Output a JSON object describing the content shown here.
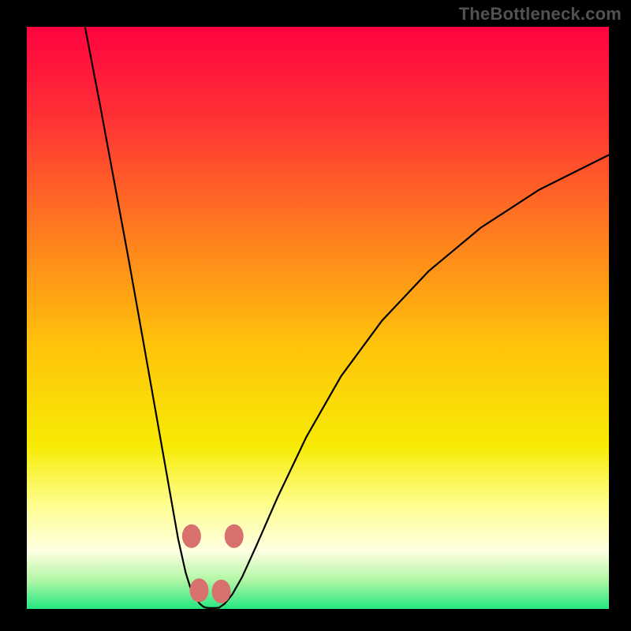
{
  "attribution": "TheBottleneck.com",
  "chart_data": {
    "type": "line",
    "title": "",
    "xlabel": "",
    "ylabel": "",
    "xlim": [
      0,
      100
    ],
    "ylim": [
      0,
      100
    ],
    "grid": false,
    "legend": false,
    "background_gradient": {
      "type": "vertical",
      "stops": [
        {
          "pos": 0.0,
          "color": "#ff0340"
        },
        {
          "pos": 0.15,
          "color": "#ff2f35"
        },
        {
          "pos": 0.35,
          "color": "#ff7b1f"
        },
        {
          "pos": 0.55,
          "color": "#ffc40a"
        },
        {
          "pos": 0.72,
          "color": "#f7eb04"
        },
        {
          "pos": 0.82,
          "color": "#fefe8e"
        },
        {
          "pos": 0.9,
          "color": "#ffffe2"
        },
        {
          "pos": 0.95,
          "color": "#b3f6a6"
        },
        {
          "pos": 1.0,
          "color": "#24e780"
        }
      ]
    },
    "series": [
      {
        "name": "left-curve",
        "stroke": "#000000",
        "x": [
          10.0,
          12.5,
          15.0,
          17.5,
          20.0,
          21.5,
          23.0,
          24.5,
          26.0,
          27.3,
          28.3,
          29.0,
          29.7,
          30.3,
          30.8
        ],
        "y": [
          100.0,
          87.0,
          73.5,
          60.0,
          46.0,
          37.5,
          29.0,
          20.5,
          12.0,
          6.2,
          3.0,
          1.8,
          0.9,
          0.4,
          0.2
        ]
      },
      {
        "name": "flat-bottom",
        "stroke": "#000000",
        "x": [
          30.8,
          31.5,
          32.3,
          33.0
        ],
        "y": [
          0.2,
          0.15,
          0.15,
          0.2
        ]
      },
      {
        "name": "right-curve",
        "stroke": "#000000",
        "x": [
          33.0,
          34.0,
          35.3,
          37.0,
          39.5,
          43.0,
          48.0,
          54.0,
          61.0,
          69.0,
          78.0,
          88.0,
          100.0
        ],
        "y": [
          0.2,
          0.9,
          2.5,
          5.5,
          11.0,
          19.0,
          29.5,
          40.0,
          49.5,
          58.0,
          65.5,
          72.0,
          78.0
        ]
      }
    ],
    "markers": [
      {
        "name": "inflection-left-upper",
        "x": 28.3,
        "y": 12.5,
        "color": "#d8706d",
        "r": 12
      },
      {
        "name": "inflection-left-lower",
        "x": 29.6,
        "y": 3.2,
        "color": "#d8706d",
        "r": 12
      },
      {
        "name": "inflection-right-lower",
        "x": 33.4,
        "y": 3.0,
        "color": "#d8706d",
        "r": 12
      },
      {
        "name": "inflection-right-upper",
        "x": 35.6,
        "y": 12.5,
        "color": "#d8706d",
        "r": 12
      }
    ]
  }
}
